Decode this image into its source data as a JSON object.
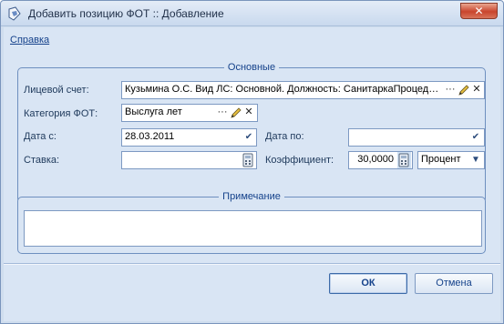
{
  "window": {
    "title": "Добавить позицию ФОТ :: Добавление",
    "close_glyph": "✕"
  },
  "menu": {
    "help": "Справка"
  },
  "main_group": {
    "legend": "Основные",
    "account_label": "Лицевой счет:",
    "account_value": "Кузьмина О.С. Вид ЛС: Основной. Должность: СанитаркаПроцед…",
    "category_label": "Категория ФОТ:",
    "category_value": "Выслуга лет",
    "date_from_label": "Дата с:",
    "date_from_value": "28.03.2011",
    "date_to_label": "Дата по:",
    "date_to_value": "",
    "rate_label": "Ставка:",
    "rate_value": "",
    "coef_label": "Коэффициент:",
    "coef_value": "30,0000",
    "unit_value": "Процент"
  },
  "note_group": {
    "legend": "Примечание",
    "value": ""
  },
  "buttons": {
    "ok": "ОК",
    "cancel": "Отмена"
  },
  "icons": {
    "ellipsis": "···",
    "clear": "✕",
    "dropdown": "▼",
    "check": "✔"
  },
  "colors": {
    "accent": "#15428b",
    "frame": "#6e8fbf",
    "client_bg": "#d9e5f4"
  }
}
